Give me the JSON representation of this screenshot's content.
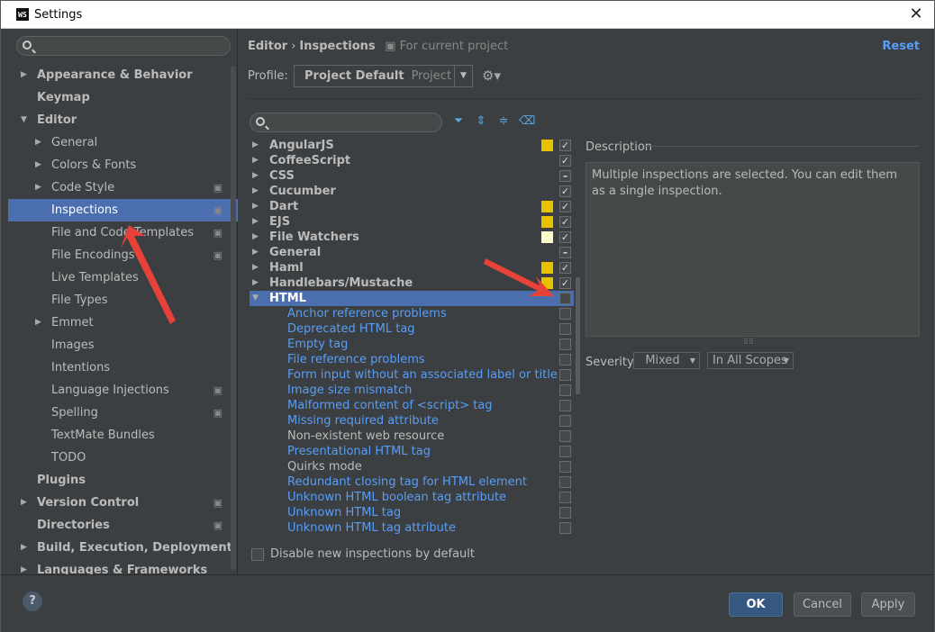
{
  "window": {
    "title": "Settings",
    "app_icon": "WS"
  },
  "left": {
    "search_placeholder": "",
    "tree": [
      {
        "label": "Appearance & Behavior",
        "level": 0,
        "expander": "collapsed",
        "bold": true,
        "project": false
      },
      {
        "label": "Keymap",
        "level": 0,
        "expander": "none",
        "bold": true,
        "project": false
      },
      {
        "label": "Editor",
        "level": 0,
        "expander": "expanded",
        "bold": true,
        "project": false
      },
      {
        "label": "General",
        "level": 1,
        "expander": "collapsed",
        "bold": false,
        "project": false
      },
      {
        "label": "Colors & Fonts",
        "level": 1,
        "expander": "collapsed",
        "bold": false,
        "project": false
      },
      {
        "label": "Code Style",
        "level": 1,
        "expander": "collapsed",
        "bold": false,
        "project": true
      },
      {
        "label": "Inspections",
        "level": 1,
        "expander": "none",
        "bold": false,
        "project": true,
        "selected": true
      },
      {
        "label": "File and Code Templates",
        "level": 1,
        "expander": "none",
        "bold": false,
        "project": true
      },
      {
        "label": "File Encodings",
        "level": 1,
        "expander": "none",
        "bold": false,
        "project": true
      },
      {
        "label": "Live Templates",
        "level": 1,
        "expander": "none",
        "bold": false,
        "project": false
      },
      {
        "label": "File Types",
        "level": 1,
        "expander": "none",
        "bold": false,
        "project": false
      },
      {
        "label": "Emmet",
        "level": 1,
        "expander": "collapsed",
        "bold": false,
        "project": false
      },
      {
        "label": "Images",
        "level": 1,
        "expander": "none",
        "bold": false,
        "project": false
      },
      {
        "label": "Intentions",
        "level": 1,
        "expander": "none",
        "bold": false,
        "project": false
      },
      {
        "label": "Language Injections",
        "level": 1,
        "expander": "none",
        "bold": false,
        "project": true
      },
      {
        "label": "Spelling",
        "level": 1,
        "expander": "none",
        "bold": false,
        "project": true
      },
      {
        "label": "TextMate Bundles",
        "level": 1,
        "expander": "none",
        "bold": false,
        "project": false
      },
      {
        "label": "TODO",
        "level": 1,
        "expander": "none",
        "bold": false,
        "project": false
      },
      {
        "label": "Plugins",
        "level": 0,
        "expander": "none",
        "bold": true,
        "project": false
      },
      {
        "label": "Version Control",
        "level": 0,
        "expander": "collapsed",
        "bold": true,
        "project": true
      },
      {
        "label": "Directories",
        "level": 0,
        "expander": "none",
        "bold": true,
        "project": true
      },
      {
        "label": "Build, Execution, Deployment",
        "level": 0,
        "expander": "collapsed",
        "bold": true,
        "project": false
      },
      {
        "label": "Languages & Frameworks",
        "level": 0,
        "expander": "collapsed",
        "bold": true,
        "project": false
      }
    ]
  },
  "header": {
    "breadcrumb_parent": "Editor",
    "breadcrumb_sep": "›",
    "breadcrumb_current": "Inspections",
    "scope_note": "For current project",
    "reset_label": "Reset"
  },
  "profile": {
    "label": "Profile:",
    "name": "Project Default",
    "kind": "Project"
  },
  "inspections": [
    {
      "label": "AngularJS",
      "group": true,
      "sev": "#e5c300",
      "checked": true
    },
    {
      "label": "CoffeeScript",
      "group": true,
      "sev": "",
      "checked": true
    },
    {
      "label": "CSS",
      "group": true,
      "sev": "",
      "checked": "mixed"
    },
    {
      "label": "Cucumber",
      "group": true,
      "sev": "",
      "checked": true
    },
    {
      "label": "Dart",
      "group": true,
      "sev": "#e5c300",
      "checked": true
    },
    {
      "label": "EJS",
      "group": true,
      "sev": "#e5c300",
      "checked": true
    },
    {
      "label": "File Watchers",
      "group": true,
      "sev": "#fff8c8",
      "checked": true
    },
    {
      "label": "General",
      "group": true,
      "sev": "",
      "checked": "mixed"
    },
    {
      "label": "Haml",
      "group": true,
      "sev": "#e5c300",
      "checked": true
    },
    {
      "label": "Handlebars/Mustache",
      "group": true,
      "sev": "#e5c300",
      "checked": true
    },
    {
      "label": "HTML",
      "group": true,
      "expanded": true,
      "selected": true,
      "sev": "",
      "checked": false
    },
    {
      "label": "Anchor reference problems",
      "group": false,
      "link": true,
      "checked": false
    },
    {
      "label": "Deprecated HTML tag",
      "group": false,
      "link": true,
      "checked": false
    },
    {
      "label": "Empty tag",
      "group": false,
      "link": true,
      "checked": false
    },
    {
      "label": "File reference problems",
      "group": false,
      "link": true,
      "checked": false
    },
    {
      "label": "Form input without an associated label or title a",
      "group": false,
      "link": true,
      "checked": false
    },
    {
      "label": "Image size mismatch",
      "group": false,
      "link": true,
      "checked": false
    },
    {
      "label": "Malformed content of <script> tag",
      "group": false,
      "link": true,
      "checked": false
    },
    {
      "label": "Missing required attribute",
      "group": false,
      "link": true,
      "checked": false
    },
    {
      "label": "Non-existent web resource",
      "group": false,
      "link": false,
      "checked": false
    },
    {
      "label": "Presentational HTML tag",
      "group": false,
      "link": true,
      "checked": false
    },
    {
      "label": "Quirks mode",
      "group": false,
      "link": false,
      "checked": false
    },
    {
      "label": "Redundant closing tag for HTML element",
      "group": false,
      "link": true,
      "checked": false
    },
    {
      "label": "Unknown HTML boolean tag attribute",
      "group": false,
      "link": true,
      "checked": false
    },
    {
      "label": "Unknown HTML tag",
      "group": false,
      "link": true,
      "checked": false
    },
    {
      "label": "Unknown HTML tag attribute",
      "group": false,
      "link": true,
      "checked": false
    }
  ],
  "description": {
    "label": "Description",
    "text": "Multiple inspections are selected. You can edit them as a single inspection."
  },
  "severity": {
    "label": "Severity:",
    "value": "Mixed",
    "scope": "In All Scopes"
  },
  "disable_new": {
    "label": "Disable new inspections by default",
    "checked": false
  },
  "buttons": {
    "ok": "OK",
    "cancel": "Cancel",
    "apply": "Apply",
    "help": "?"
  },
  "colors": {
    "selection": "#4b6eaf",
    "link": "#589df6",
    "accent_arrow": "#e8413a"
  }
}
